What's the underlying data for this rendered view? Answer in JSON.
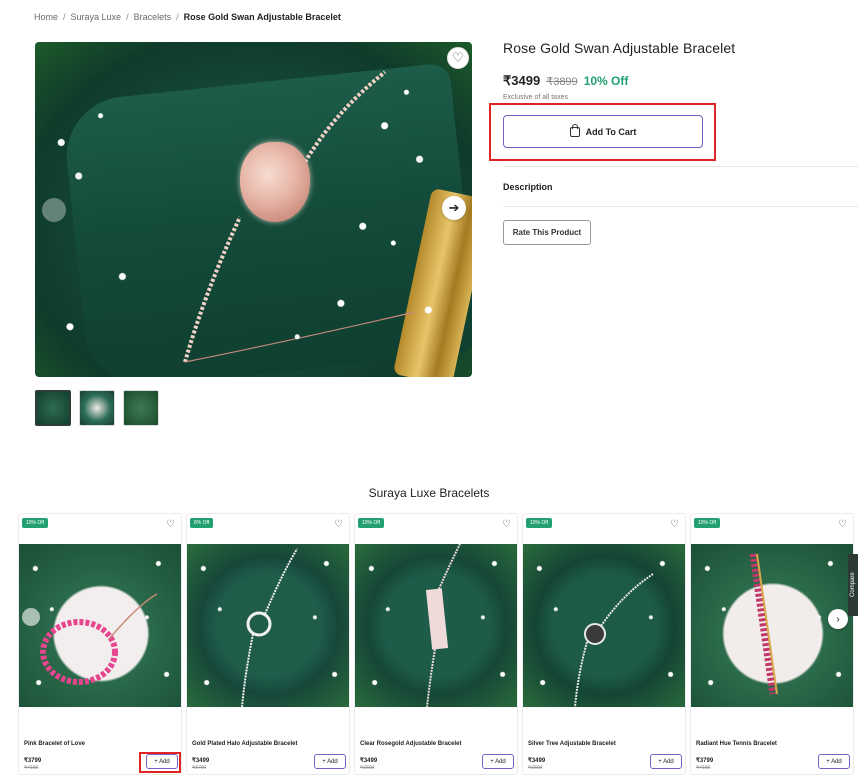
{
  "breadcrumb": {
    "items": [
      "Home",
      "Suraya Luxe",
      "Bracelets"
    ],
    "current": "Rose Gold Swan Adjustable Bracelet",
    "separator": "/"
  },
  "product": {
    "title": "Rose Gold Swan Adjustable Bracelet",
    "price": "₹3499",
    "old_price": "₹3899",
    "discount": "10% Off",
    "tax_note": "Exclusive of all taxes",
    "add_to_cart_label": "Add To Cart",
    "description_label": "Description",
    "rate_label": "Rate This Product",
    "wishlist_icon": "♡",
    "next_icon": "➔"
  },
  "colors": {
    "accent": "#7b5cc9",
    "discount_green": "#23a06f",
    "highlight_red": "#e02424"
  },
  "related": {
    "title": "Suraya Luxe Bracelets",
    "add_label": "+ Add",
    "side_tab_label": "Compare",
    "products": [
      {
        "badge": "10% Off",
        "name": "Pink Bracelet of Love",
        "price": "₹3799",
        "old_price": "₹4199"
      },
      {
        "badge": "8% Off",
        "name": "Gold Plated Halo Adjustable Bracelet",
        "price": "₹3499",
        "old_price": "₹3799"
      },
      {
        "badge": "10% Off",
        "name": "Clear Rosegold Adjustable Bracelet",
        "price": "₹3499",
        "old_price": "₹3899"
      },
      {
        "badge": "10% Off",
        "name": "Silver Tree Adjustable Bracelet",
        "price": "₹3499",
        "old_price": "₹3899"
      },
      {
        "badge": "10% Off",
        "name": "Radiant Hue Tennis Bracelet",
        "price": "₹3799",
        "old_price": "₹4199"
      }
    ]
  }
}
